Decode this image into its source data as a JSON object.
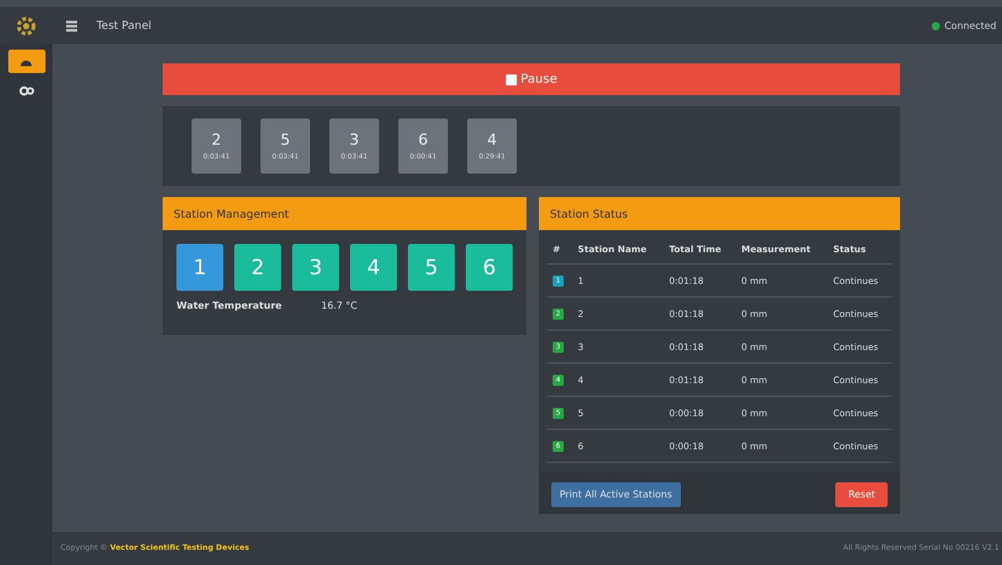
{
  "header": {
    "title": "Test Panel",
    "connection": {
      "label": "Connected",
      "color": "#28a745"
    }
  },
  "sidebar": {
    "items": [
      {
        "kind": "gauge",
        "selected": true
      },
      {
        "kind": "gears",
        "selected": false
      }
    ]
  },
  "pause_button": {
    "label": "Pause",
    "checked": false
  },
  "timers": [
    {
      "number": "2",
      "time": "0:03:41"
    },
    {
      "number": "5",
      "time": "0:03:41"
    },
    {
      "number": "3",
      "time": "0:03:41"
    },
    {
      "number": "6",
      "time": "0:00:41"
    },
    {
      "number": "4",
      "time": "0:29:41"
    }
  ],
  "station_management": {
    "title": "Station Management",
    "stations": [
      {
        "label": "1",
        "selected": true
      },
      {
        "label": "2",
        "selected": false
      },
      {
        "label": "3",
        "selected": false
      },
      {
        "label": "4",
        "selected": false
      },
      {
        "label": "5",
        "selected": false
      },
      {
        "label": "6",
        "selected": false
      }
    ],
    "reading_label": "Water Temperature",
    "reading_value": "16.7 °C"
  },
  "station_status": {
    "title": "Station Status",
    "columns": [
      "#",
      "Station Name",
      "Total Time",
      "Measurement",
      "Status"
    ],
    "rows": [
      {
        "badge": "1",
        "color": "#17a2b8",
        "name": "1",
        "time": "0:01:18",
        "measurement": "0 mm",
        "status": "Continues"
      },
      {
        "badge": "2",
        "color": "#28a745",
        "name": "2",
        "time": "0:01:18",
        "measurement": "0 mm",
        "status": "Continues"
      },
      {
        "badge": "3",
        "color": "#28a745",
        "name": "3",
        "time": "0:01:18",
        "measurement": "0 mm",
        "status": "Continues"
      },
      {
        "badge": "4",
        "color": "#28a745",
        "name": "4",
        "time": "0:01:18",
        "measurement": "0 mm",
        "status": "Continues"
      },
      {
        "badge": "5",
        "color": "#28a745",
        "name": "5",
        "time": "0:00:18",
        "measurement": "0 mm",
        "status": "Continues"
      },
      {
        "badge": "6",
        "color": "#28a745",
        "name": "6",
        "time": "0:00:18",
        "measurement": "0 mm",
        "status": "Continues"
      }
    ],
    "print_button": "Print All Active Stations",
    "reset_button": "Reset"
  },
  "footer": {
    "copyright": "Copyright ©",
    "company": "Vector Scientific Testing Devices",
    "rights": "All Rights Reserved Serial No 00216 V2.1"
  }
}
